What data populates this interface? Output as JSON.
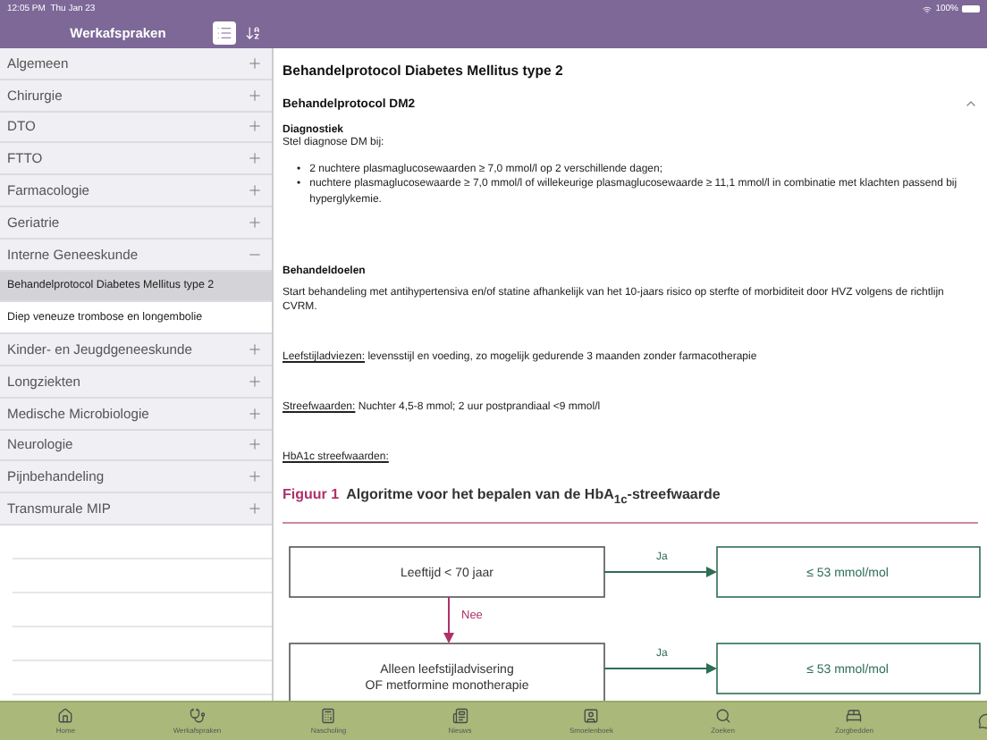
{
  "status_bar": {
    "time": "12:05 PM",
    "date": "Thu Jan 23",
    "battery": "100%"
  },
  "sidebar": {
    "title": "Werkafspraken",
    "view_buttons": [
      {
        "kind": "list",
        "selected": true
      },
      {
        "kind": "sort",
        "selected": false
      }
    ],
    "items": [
      {
        "label": "Algemeen",
        "expanded": false
      },
      {
        "label": "Chirurgie",
        "expanded": false
      },
      {
        "label": "DTO",
        "expanded": false
      },
      {
        "label": "FTTO",
        "expanded": false
      },
      {
        "label": "Farmacologie",
        "expanded": false
      },
      {
        "label": "Geriatrie",
        "expanded": false
      },
      {
        "label": "Interne Geneeskunde",
        "expanded": true,
        "children": [
          {
            "label": "Behandelprotocol Diabetes Mellitus type 2",
            "selected": true
          },
          {
            "label": "Diep veneuze trombose en longembolie",
            "selected": false
          }
        ]
      },
      {
        "label": "Kinder- en Jeugdgeneeskunde",
        "expanded": false
      },
      {
        "label": "Longziekten",
        "expanded": false
      },
      {
        "label": "Medische Microbiologie",
        "expanded": false
      },
      {
        "label": "Neurologie",
        "expanded": false
      },
      {
        "label": "Pijnbehandeling",
        "expanded": false
      },
      {
        "label": "Transmurale MIP",
        "expanded": false
      }
    ]
  },
  "content": {
    "title": "Behandelprotocol Diabetes Mellitus type 2",
    "section": {
      "title": "Behandelprotocol DM2",
      "expanded": true,
      "blocks": [
        {
          "kind": "heading",
          "text": "Diagnostiek"
        },
        {
          "kind": "text",
          "text": "Stel diagnose DM bij:"
        },
        {
          "kind": "list",
          "marker": "•",
          "items": [
            "2 nuchtere plasmaglucosewaarden ≥ 7,0 mmol/l op 2 verschillende dagen;",
            "nuchtere plasmaglucosewaarde ≥ 7,0 mmol/l of willekeurige plasmaglucosewaarde ≥ 11,1 mmol/l in combinatie met klachten passend bij hyperglykemie."
          ]
        },
        {
          "kind": "heading",
          "text": "Behandeldoelen"
        },
        {
          "kind": "text",
          "text": "Start behandeling met antihypertensiva en/of statine afhankelijk van het 10-jaars risico op sterfte of morbiditeit door HVZ volgens de richtlijn CVRM."
        },
        {
          "kind": "labeled",
          "label": "Leefstijladviezen:",
          "text": " levensstijl en voeding, zo mogelijk gedurende 3 maanden zonder farmacotherapie"
        },
        {
          "kind": "labeled",
          "label": "Streefwaarden:",
          "text": "Nuchter 4,5-8 mmol; 2 uur postprandiaal <9 mmol/l"
        },
        {
          "kind": "labeled",
          "label": "HbA1c streefwaarden:"
        }
      ],
      "figure": {
        "number": "Figuur 1",
        "caption": "Algoritme voor het bepalen van de HbA$_{1c}$-streefwaarde",
        "steps": [
          {
            "condition": "Leeftijd < 70 jaar",
            "yes_label": "Ja",
            "result": "≤ 53 mmol/mol",
            "no_label": "Nee"
          },
          {
            "condition": "Alleen leefstijladvisering OF metformine monotherapie",
            "yes_label": "Ja",
            "result": "≤ 53 mmol/mol"
          }
        ]
      }
    }
  },
  "tab_bar": [
    {
      "kind": "home",
      "label": "Home"
    },
    {
      "kind": "stethoscope",
      "label": "Werkafspraken"
    },
    {
      "kind": "calculator",
      "label": "Nascholing"
    },
    {
      "kind": "news",
      "label": "Nieuws"
    },
    {
      "kind": "contact",
      "label": "Smoelenboek"
    },
    {
      "kind": "search",
      "label": "Zoeken"
    },
    {
      "kind": "bed",
      "label": "Zorgbedden"
    },
    {
      "kind": "chat"
    }
  ]
}
